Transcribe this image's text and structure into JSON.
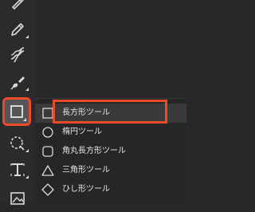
{
  "toolbar": {
    "tools": [
      {
        "icon": "pen-icon"
      },
      {
        "icon": "pencil-icon"
      },
      {
        "icon": "mixer-brush-icon"
      },
      {
        "icon": "brush-icon"
      },
      {
        "icon": "rectangle-tool-icon",
        "active": true
      },
      {
        "icon": "lasso-ellipse-icon"
      },
      {
        "icon": "type-tool-icon"
      },
      {
        "icon": "image-icon"
      }
    ]
  },
  "flyout": {
    "items": [
      {
        "label": "長方形ツール",
        "icon": "rectangle-icon",
        "selected": true
      },
      {
        "label": "楕円ツール",
        "icon": "ellipse-icon"
      },
      {
        "label": "角丸長方形ツール",
        "icon": "rounded-rectangle-icon"
      },
      {
        "label": "三角形ツール",
        "icon": "triangle-icon"
      },
      {
        "label": "ひし形ツール",
        "icon": "diamond-icon"
      }
    ]
  },
  "colors": {
    "background": "#282828",
    "highlight": "#e84a2a",
    "icon": "#d9d9d9",
    "text": "#e6e6e6",
    "active_tool_bg": "#555555"
  }
}
